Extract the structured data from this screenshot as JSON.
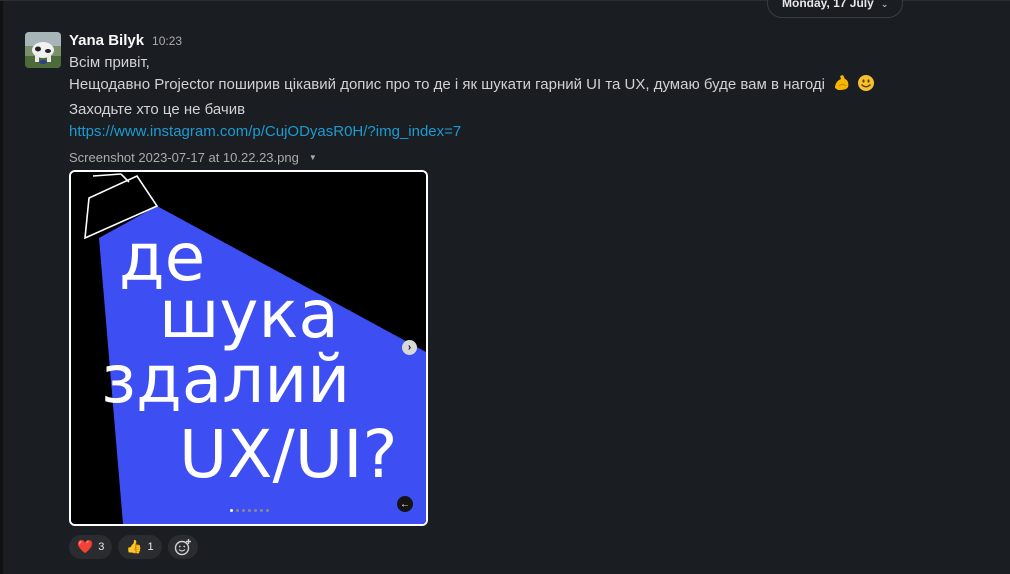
{
  "date_divider": {
    "label": "Monday, 17 July",
    "chevron_icon": "chevron-down-icon"
  },
  "message": {
    "author": "Yana Bilyk",
    "time": "10:23",
    "lines": [
      "Всім привіт,",
      "Нещодавно Projector поширив цікавий допис про то де і як шукати гарний UI та UX, думаю буде вам в нагоді",
      "Заходьте хто це не бачив"
    ],
    "emojis": [
      "flexed-biceps-icon",
      "smiling-face-icon"
    ],
    "link": "https://www.instagram.com/p/CujODyasR0H/?img_index=7",
    "file": {
      "name": "Screenshot 2023-07-17 at 10.22.23.png",
      "caret_icon": "caret-down-icon"
    },
    "image_text": [
      "де",
      "шука",
      "здалий",
      "UX/UI?"
    ]
  },
  "carousel": {
    "slide_count": 7,
    "active_index": 0
  },
  "reactions": [
    {
      "icon": "red-heart-icon",
      "glyph": "❤️",
      "count": "3"
    },
    {
      "icon": "thumbs-up-icon",
      "glyph": "👍",
      "count": "1"
    }
  ],
  "colors": {
    "background": "#1a1d21",
    "link": "#1d9bd1",
    "spotlight": "#3d4ef2"
  }
}
